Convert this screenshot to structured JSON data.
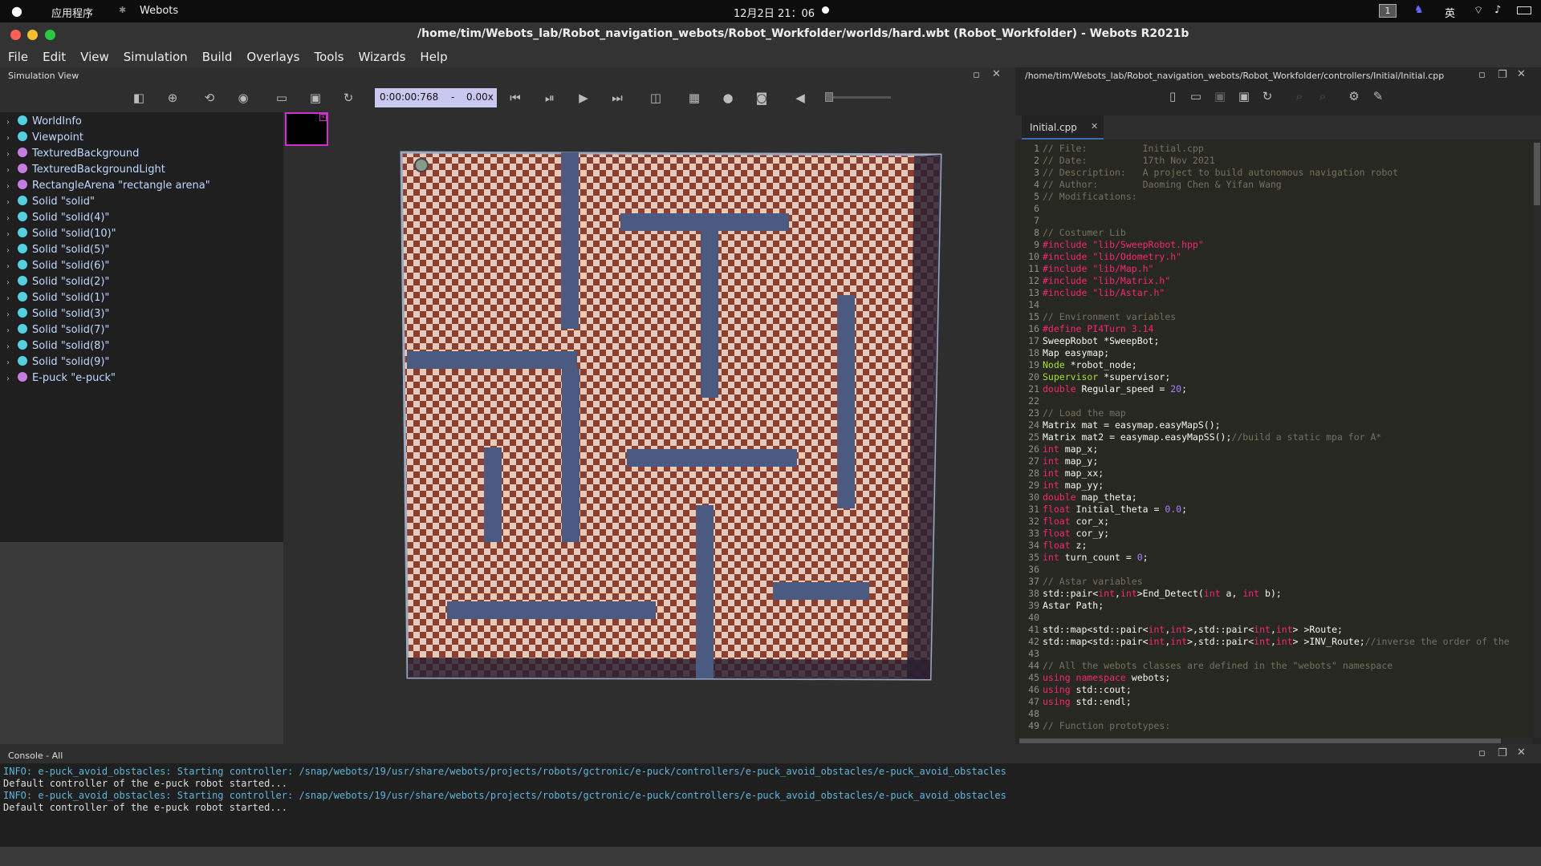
{
  "topbar": {
    "apps_label": "应用程序",
    "app_name": "Webots",
    "clock": "12月2日 21：06",
    "workspace": "1",
    "input_method": "英"
  },
  "window": {
    "title": "/home/tim/Webots_lab/Robot_navigation_webots/Robot_Workfolder/worlds/hard.wbt (Robot_Workfolder) - Webots R2021b"
  },
  "menu": [
    "File",
    "Edit",
    "View",
    "Simulation",
    "Build",
    "Overlays",
    "Tools",
    "Wizards",
    "Help"
  ],
  "simulation_view": {
    "header": "Simulation View",
    "time": "0:00:00:768",
    "separator": "-",
    "speed": "0.00x"
  },
  "scene_tree": [
    {
      "label": "WorldInfo",
      "color": "#55d0e0"
    },
    {
      "label": "Viewpoint",
      "color": "#55d0e0"
    },
    {
      "label": "TexturedBackground",
      "color": "#c77ce0"
    },
    {
      "label": "TexturedBackgroundLight",
      "color": "#c77ce0"
    },
    {
      "label": "RectangleArena \"rectangle arena\"",
      "color": "#c77ce0"
    },
    {
      "label": "Solid \"solid\"",
      "color": "#55d0e0"
    },
    {
      "label": "Solid \"solid(4)\"",
      "color": "#55d0e0"
    },
    {
      "label": "Solid \"solid(10)\"",
      "color": "#55d0e0"
    },
    {
      "label": "Solid \"solid(5)\"",
      "color": "#55d0e0"
    },
    {
      "label": "Solid \"solid(6)\"",
      "color": "#55d0e0"
    },
    {
      "label": "Solid \"solid(2)\"",
      "color": "#55d0e0"
    },
    {
      "label": "Solid \"solid(1)\"",
      "color": "#55d0e0"
    },
    {
      "label": "Solid \"solid(3)\"",
      "color": "#55d0e0"
    },
    {
      "label": "Solid \"solid(7)\"",
      "color": "#55d0e0"
    },
    {
      "label": "Solid \"solid(8)\"",
      "color": "#55d0e0"
    },
    {
      "label": "Solid \"solid(9)\"",
      "color": "#55d0e0"
    },
    {
      "label": "E-puck \"e-puck\"",
      "color": "#c77ce0"
    }
  ],
  "editor": {
    "path": "/home/tim/Webots_lab/Robot_navigation_webots/Robot_Workfolder/controllers/Initial/Initial.cpp",
    "tab": "Initial.cpp",
    "lines": [
      [
        [
          "c",
          "// File:          Initial.cpp"
        ]
      ],
      [
        [
          "c",
          "// Date:          17th Nov 2021"
        ]
      ],
      [
        [
          "c",
          "// Description:   A project to build autonomous navigation robot"
        ]
      ],
      [
        [
          "c",
          "// Author:        Daoming Chen & Yifan Wang"
        ]
      ],
      [
        [
          "c",
          "// Modifications:"
        ]
      ],
      [],
      [],
      [
        [
          "c",
          "// Costumer Lib"
        ]
      ],
      [
        [
          "k",
          "#include \"lib/SweepRobot.hpp\""
        ]
      ],
      [
        [
          "k",
          "#include \"lib/Odometry.h\""
        ]
      ],
      [
        [
          "k",
          "#include \"lib/Map.h\""
        ]
      ],
      [
        [
          "k",
          "#include \"lib/Matrix.h\""
        ]
      ],
      [
        [
          "k",
          "#include \"lib/Astar.h\""
        ]
      ],
      [],
      [
        [
          "c",
          "// Environment variables"
        ]
      ],
      [
        [
          "k",
          "#define PI4Turn 3.14"
        ]
      ],
      [
        [
          "p",
          "SweepRobot *SweepBot;"
        ]
      ],
      [
        [
          "p",
          "Map easymap;"
        ]
      ],
      [
        [
          "t",
          "Node"
        ],
        [
          "p",
          " *robot_node;"
        ]
      ],
      [
        [
          "t",
          "Supervisor"
        ],
        [
          "p",
          " *supervisor;"
        ]
      ],
      [
        [
          "k",
          "double"
        ],
        [
          "p",
          " Regular_speed = "
        ],
        [
          "n",
          "20"
        ],
        [
          "p",
          ";"
        ]
      ],
      [],
      [
        [
          "c",
          "// Load the map"
        ]
      ],
      [
        [
          "p",
          "Matrix mat = easymap.easyMapS();"
        ]
      ],
      [
        [
          "p",
          "Matrix mat2 = easymap.easyMapSS();"
        ],
        [
          "c",
          "//build a static mpa for A*"
        ]
      ],
      [
        [
          "k",
          "int"
        ],
        [
          "p",
          " map_x;"
        ]
      ],
      [
        [
          "k",
          "int"
        ],
        [
          "p",
          " map_y;"
        ]
      ],
      [
        [
          "k",
          "int"
        ],
        [
          "p",
          " map_xx;"
        ]
      ],
      [
        [
          "k",
          "int"
        ],
        [
          "p",
          " map_yy;"
        ]
      ],
      [
        [
          "k",
          "double"
        ],
        [
          "p",
          " map_theta;"
        ]
      ],
      [
        [
          "k",
          "float"
        ],
        [
          "p",
          " Initial_theta = "
        ],
        [
          "n",
          "0.0"
        ],
        [
          "p",
          ";"
        ]
      ],
      [
        [
          "k",
          "float"
        ],
        [
          "p",
          " cor_x;"
        ]
      ],
      [
        [
          "k",
          "float"
        ],
        [
          "p",
          " cor_y;"
        ]
      ],
      [
        [
          "k",
          "float"
        ],
        [
          "p",
          " z;"
        ]
      ],
      [
        [
          "k",
          "int"
        ],
        [
          "p",
          " turn_count = "
        ],
        [
          "n",
          "0"
        ],
        [
          "p",
          ";"
        ]
      ],
      [],
      [
        [
          "c",
          "// Astar variables"
        ]
      ],
      [
        [
          "p",
          "std::pair<"
        ],
        [
          "k",
          "int"
        ],
        [
          "p",
          ","
        ],
        [
          "k",
          "int"
        ],
        [
          "p",
          ">End_Detect("
        ],
        [
          "k",
          "int"
        ],
        [
          "p",
          " a, "
        ],
        [
          "k",
          "int"
        ],
        [
          "p",
          " b);"
        ]
      ],
      [
        [
          "p",
          "Astar Path;"
        ]
      ],
      [],
      [
        [
          "p",
          "std::map<std::pair<"
        ],
        [
          "k",
          "int"
        ],
        [
          "p",
          ","
        ],
        [
          "k",
          "int"
        ],
        [
          "p",
          ">,std::pair<"
        ],
        [
          "k",
          "int"
        ],
        [
          "p",
          ","
        ],
        [
          "k",
          "int"
        ],
        [
          "p",
          "> >Route;"
        ]
      ],
      [
        [
          "p",
          "std::map<std::pair<"
        ],
        [
          "k",
          "int"
        ],
        [
          "p",
          ","
        ],
        [
          "k",
          "int"
        ],
        [
          "p",
          ">,std::pair<"
        ],
        [
          "k",
          "int"
        ],
        [
          "p",
          ","
        ],
        [
          "k",
          "int"
        ],
        [
          "p",
          "> >INV_Route;"
        ],
        [
          "c",
          "//inverse the order of the"
        ]
      ],
      [],
      [
        [
          "c",
          "// All the webots classes are defined in the \"webots\" namespace"
        ]
      ],
      [
        [
          "k",
          "using namespace"
        ],
        [
          "p",
          " webots;"
        ]
      ],
      [
        [
          "k",
          "using"
        ],
        [
          "p",
          " std::cout;"
        ]
      ],
      [
        [
          "k",
          "using"
        ],
        [
          "p",
          " std::endl;"
        ]
      ],
      [],
      [
        [
          "c",
          "// Function prototypes:"
        ]
      ]
    ]
  },
  "console": {
    "header": "Console - All",
    "lines": [
      {
        "text": "INFO: e-puck_avoid_obstacles: Starting controller: /snap/webots/19/usr/share/webots/projects/robots/gctronic/e-puck/controllers/e-puck_avoid_obstacles/e-puck_avoid_obstacles",
        "color": "#5fb3d9"
      },
      {
        "text": "Default controller of the e-puck robot started...",
        "color": "#dddddd"
      },
      {
        "text": "INFO: e-puck_avoid_obstacles: Starting controller: /snap/webots/19/usr/share/webots/projects/robots/gctronic/e-puck/controllers/e-puck_avoid_obstacles/e-puck_avoid_obstacles",
        "color": "#5fb3d9"
      },
      {
        "text": "Default controller of the e-puck robot started...",
        "color": "#dddddd"
      }
    ]
  },
  "colors": {
    "comment": "#75715e",
    "keyword": "#f92672",
    "type": "#a6e22e",
    "number": "#ae81ff",
    "plain": "#f8f8f2",
    "wall": "#4a5a80",
    "floor_light": "#e8c8b8",
    "floor_dark": "#8a4030"
  },
  "icons": [
    "apple-icon",
    "toggle-tree-icon",
    "add-node-icon",
    "reset-view-icon",
    "eye-icon",
    "open-world-icon",
    "save-world-icon",
    "reload-world-icon",
    "step-back-icon",
    "step-icon",
    "play-icon",
    "fast-forward-icon",
    "render-toggle-icon",
    "record-icon",
    "camera-icon",
    "mute-icon",
    "new-file-icon",
    "open-file-icon",
    "save-file-icon",
    "save-all-icon",
    "revert-icon",
    "find-icon",
    "replace-icon",
    "gear-icon",
    "build-icon"
  ]
}
